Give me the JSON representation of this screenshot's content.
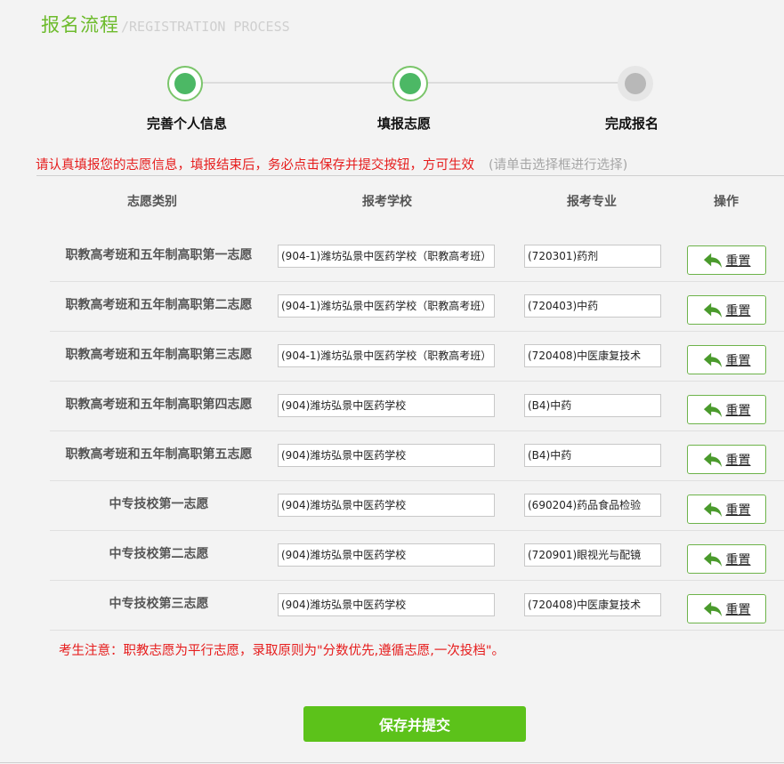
{
  "header": {
    "title_cn": "报名流程",
    "title_en": "/REGISTRATION PROCESS"
  },
  "steps": [
    {
      "label": "完善个人信息",
      "state": "done"
    },
    {
      "label": "填报志愿",
      "state": "current"
    },
    {
      "label": "完成报名",
      "state": "pending"
    }
  ],
  "notice": {
    "text": "请认真填报您的志愿信息，填报结束后，务必点击保存并提交按钮，方可生效",
    "hint": "(请单击选择框进行选择)"
  },
  "table": {
    "headers": [
      "志愿类别",
      "报考学校",
      "报考专业",
      "操作"
    ],
    "reset_label": "重置",
    "rows": [
      {
        "category": "职教高考班和五年制高职第一志愿",
        "school": "(904-1)潍坊弘景中医药学校（职教高考班）",
        "major": "(720301)药剂"
      },
      {
        "category": "职教高考班和五年制高职第二志愿",
        "school": "(904-1)潍坊弘景中医药学校（职教高考班）",
        "major": "(720403)中药"
      },
      {
        "category": "职教高考班和五年制高职第三志愿",
        "school": "(904-1)潍坊弘景中医药学校（职教高考班）",
        "major": "(720408)中医康复技术"
      },
      {
        "category": "职教高考班和五年制高职第四志愿",
        "school": "(904)潍坊弘景中医药学校",
        "major": "(B4)中药"
      },
      {
        "category": "职教高考班和五年制高职第五志愿",
        "school": "(904)潍坊弘景中医药学校",
        "major": "(B4)中药"
      },
      {
        "category": "中专技校第一志愿",
        "school": "(904)潍坊弘景中医药学校",
        "major": "(690204)药品食品检验"
      },
      {
        "category": "中专技校第二志愿",
        "school": "(904)潍坊弘景中医药学校",
        "major": "(720901)眼视光与配镜"
      },
      {
        "category": "中专技校第三志愿",
        "school": "(904)潍坊弘景中医药学校",
        "major": "(720408)中医康复技术"
      }
    ]
  },
  "note": "考生注意：职教志愿为平行志愿，录取原则为\"分数优先,遵循志愿,一次投档\"。",
  "submit_label": "保存并提交",
  "colors": {
    "accent_green": "#5cc21a",
    "step_green": "#4cb865",
    "warning_red": "#e61c1c"
  }
}
